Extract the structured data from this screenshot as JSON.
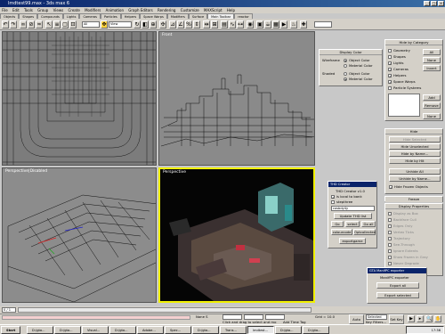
{
  "window": {
    "title": "lmdtest99.max - 3ds max 6",
    "buttons": [
      "_",
      "□",
      "x"
    ]
  },
  "menu": [
    "File",
    "Edit",
    "Tools",
    "Group",
    "Views",
    "Create",
    "Modifiers",
    "Animation",
    "Graph Editors",
    "Rendering",
    "Customize",
    "MAXScript",
    "Help"
  ],
  "tabs": [
    "Objects",
    "Shapes",
    "Compounds",
    "Lights",
    "Cameras",
    "Particles",
    "Helpers",
    "Space Warps",
    "Modifiers",
    "Surface",
    "Main Toolbar",
    "reactor"
  ],
  "active_tab": "Main Toolbar",
  "toolbar": {
    "selection_filter": "All",
    "coord_system": "View",
    "named_selection": ""
  },
  "viewports": {
    "top_left": {
      "label": ""
    },
    "front": {
      "label": "Front"
    },
    "bottom_left": {
      "label": "Perspective|Disabled"
    },
    "perspective": {
      "label": "Perspective"
    }
  },
  "display_color": {
    "title": "Display Color",
    "wireframe_label": "Wireframe",
    "shaded_label": "Shaded",
    "opt_object": "Object Color",
    "opt_material": "Material Color"
  },
  "hide_by_category": {
    "title": "Hide by Category",
    "items": [
      "Geometry",
      "Shapes",
      "Lights",
      "Cameras",
      "Helpers",
      "Space Warps",
      "Particle Systems"
    ],
    "checked": [
      false,
      false,
      true,
      true,
      true,
      true,
      false
    ],
    "all": "All",
    "none": "None",
    "invert": "Invert",
    "add": "Add",
    "remove": "Remove",
    "none2": "None"
  },
  "hide_panel": {
    "title": "Hide",
    "buttons": [
      "Hide Selected",
      "Hide Unselected",
      "Hide by Name...",
      "Hide by Hit",
      "Unhide All",
      "Unhide by Name..."
    ],
    "hide_frozen": "Hide Frozen Objects"
  },
  "freeze_title": "Freeze",
  "display_properties": {
    "title": "Display Properties",
    "items": [
      "Display as Box",
      "Backface Cull",
      "Edges Only",
      "Vertex Ticks",
      "Trajectory",
      "See-Through",
      "Ignore Extents",
      "Show Frozen in Gray",
      "Never Degrade",
      "Vertex Colors"
    ]
  },
  "thd_creator": {
    "float_title": "THD Creator",
    "title": "THD Creator v1.0",
    "is_local": "is local to bank",
    "step_three": "stepthree",
    "dropdown": "cosbdy4y",
    "update": "Update THD list",
    "go": "Go",
    "select": "select",
    "go_all": "Go all",
    "colourcode": "colourcode",
    "optcollected": "Optcollected",
    "exportgame": "exportgame"
  },
  "manifpc": {
    "float_title": "GTA ManifPC exporter",
    "title": "ManifPC exporter",
    "export_all": "Export all",
    "export_selected": "Export selected"
  },
  "timeline": {
    "frame": "0 / 1",
    "ticks": [
      "0",
      "10",
      "20",
      "30",
      "40",
      "50",
      "60",
      "70",
      "80",
      "90",
      "100"
    ]
  },
  "status": {
    "selection": "None S",
    "prompt": "Click and drag to select and mo",
    "add_time_tag": "Add Time Tag",
    "grid": "Grid = 10.0",
    "auto_key": "Auto Key",
    "set_key": "Set Key",
    "key_filters": "Key Filters...",
    "selected": "Selected",
    "coord_x": "",
    "coord_y": "",
    "coord_z": ""
  },
  "taskbar": {
    "start": "Start",
    "tasks": [
      "D:/gta...",
      "D:/gta...",
      "Visual...",
      "D:/gta...",
      "Adobe...",
      "Spec...",
      "D:/gta...",
      "Trans...",
      "lmdtest...",
      "D:/gta...",
      "D:/gta..."
    ],
    "clock": "17:36"
  },
  "colors": {
    "viewport_bg": "#808080",
    "active_border": "#f0f000",
    "panel": "#d4d0c8",
    "titlebar": "#0a246a"
  }
}
